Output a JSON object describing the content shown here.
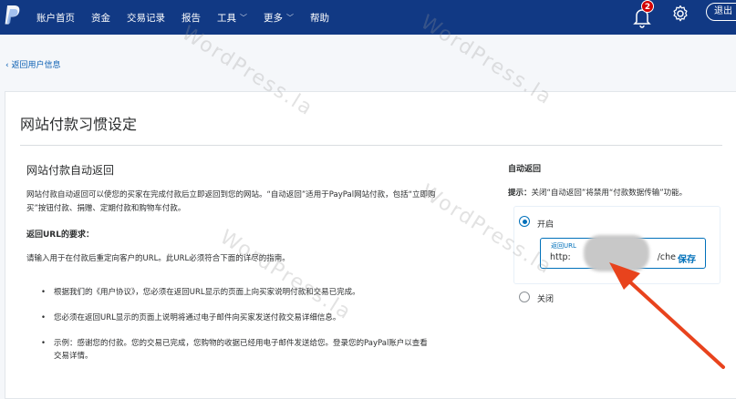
{
  "nav": {
    "items": [
      {
        "label": "账户首页",
        "has_menu": false
      },
      {
        "label": "资金",
        "has_menu": false
      },
      {
        "label": "交易记录",
        "has_menu": false
      },
      {
        "label": "报告",
        "has_menu": false
      },
      {
        "label": "工具",
        "has_menu": true
      },
      {
        "label": "更多",
        "has_menu": true
      },
      {
        "label": "帮助",
        "has_menu": false
      }
    ],
    "notification_count": "2",
    "logout_label": "退出"
  },
  "back_link": "返回用户信息",
  "page_title": "网站付款习惯设定",
  "left": {
    "section_title": "网站付款自动返回",
    "description": "网站付款自动返回可以使您的买家在完成付款后立即返回到您的网站。“自动返回”适用于PayPal网站付款，包括“立即购买”按钮付款、捐赠、定期付款和购物车付款。",
    "requirements_title": "返回URL的要求：",
    "requirements_desc": "请输入用于在付款后重定向客户的URL。此URL必须符合下面的详尽的指南。",
    "bullets": [
      "根据我们的《用户协议》，您必须在返回URL显示的页面上向买家说明付款和交易已完成。",
      "您必须在返回URL显示的页面上说明将通过电子邮件向买家发送付款交易详细信息。",
      "示例：感谢您的付款。您的交易已完成，您购物的收据已经用电子邮件发送给您。登录您的PayPal账户以查看交易详情。"
    ]
  },
  "right": {
    "title": "自动返回",
    "tip_prefix": "提示：",
    "tip_text": "关闭“自动返回”将禁用“付款数据传输”功能。",
    "option_on": "开启",
    "option_off": "关闭",
    "url_label": "返回URL",
    "url_start": "http:",
    "url_end": "/che",
    "save_label": "保存"
  },
  "watermark": "WordPress.la",
  "colors": {
    "nav_bg": "#113984",
    "link": "#0070ba",
    "arrow": "#e8431d",
    "badge": "#d20000"
  }
}
